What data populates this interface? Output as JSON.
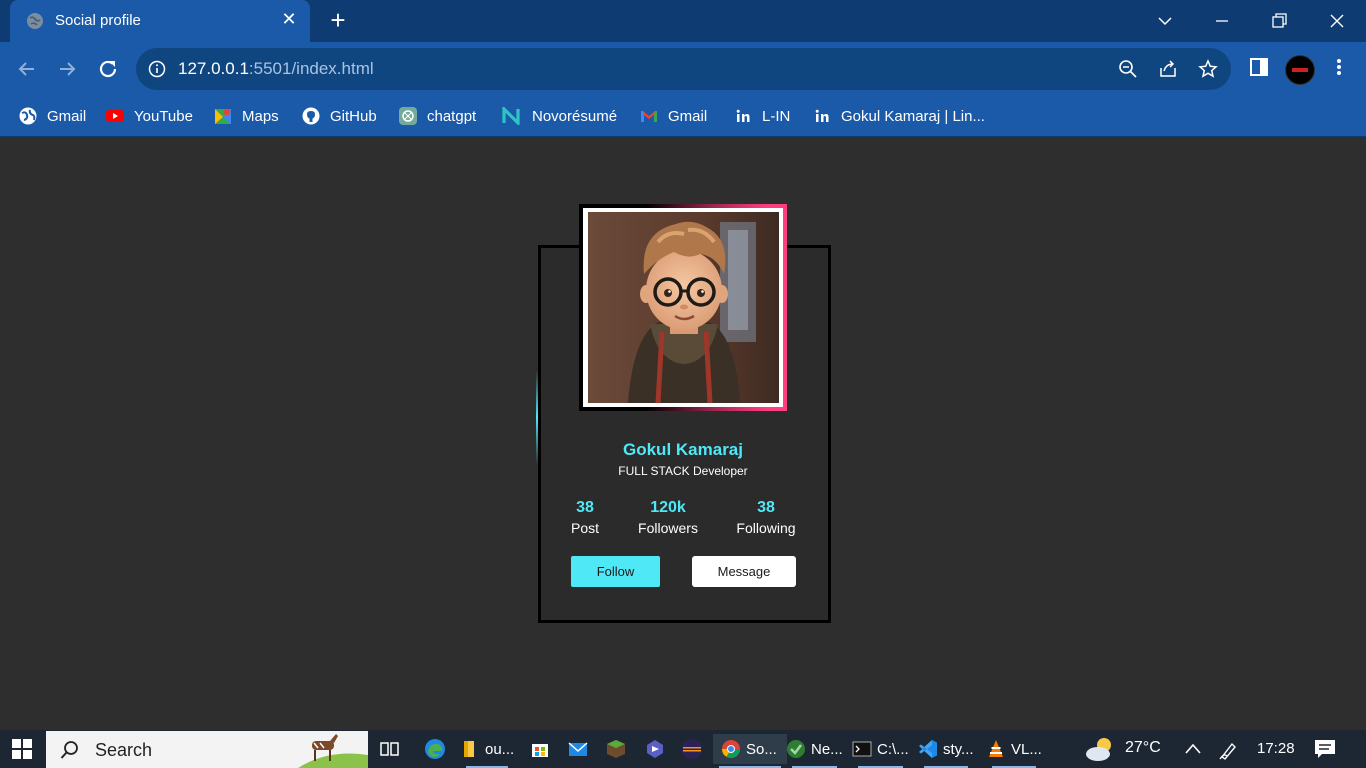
{
  "browser": {
    "tab": {
      "title": "Social profile",
      "close": "✕"
    },
    "new_tab": "+",
    "url": {
      "host": "127.0.0.1",
      "rest": ":5501/index.html"
    },
    "bookmarks": [
      {
        "label": "Gmail",
        "icon": "globe-icon"
      },
      {
        "label": "YouTube",
        "icon": "youtube-icon"
      },
      {
        "label": "Maps",
        "icon": "maps-icon"
      },
      {
        "label": "GitHub",
        "icon": "github-icon"
      },
      {
        "label": "chatgpt",
        "icon": "chatgpt-icon"
      },
      {
        "label": "Novorésumé",
        "icon": "novoresume-icon"
      },
      {
        "label": "Gmail",
        "icon": "gmail-icon"
      },
      {
        "label": "L-IN",
        "icon": "linkedin-icon"
      },
      {
        "label": "Gokul Kamaraj | Lin...",
        "icon": "linkedin-icon"
      }
    ]
  },
  "profile": {
    "name": "Gokul Kamaraj",
    "role": "FULL STACK Developer",
    "stats": [
      {
        "value": "38",
        "label": "Post"
      },
      {
        "value": "120k",
        "label": "Followers"
      },
      {
        "value": "38",
        "label": "Following"
      }
    ],
    "follow_label": "Follow",
    "message_label": "Message"
  },
  "taskbar": {
    "search_label": "Search",
    "apps": [
      {
        "label": "ou...",
        "icon": "file-explorer-icon"
      },
      {
        "label": "So...",
        "icon": "chrome-icon"
      },
      {
        "label": "Ne...",
        "icon": "browser-icon"
      },
      {
        "label": "C:\\...",
        "icon": "terminal-icon"
      },
      {
        "label": "sty...",
        "icon": "vscode-icon"
      },
      {
        "label": "VL...",
        "icon": "vlc-icon"
      }
    ],
    "weather": "27°C",
    "time": "17:28"
  },
  "colors": {
    "accent": "#4fe8f6",
    "accent_pink": "#ff3d7f",
    "page_bg": "#2e2e2e",
    "chrome_blue": "#1a5aa8"
  }
}
